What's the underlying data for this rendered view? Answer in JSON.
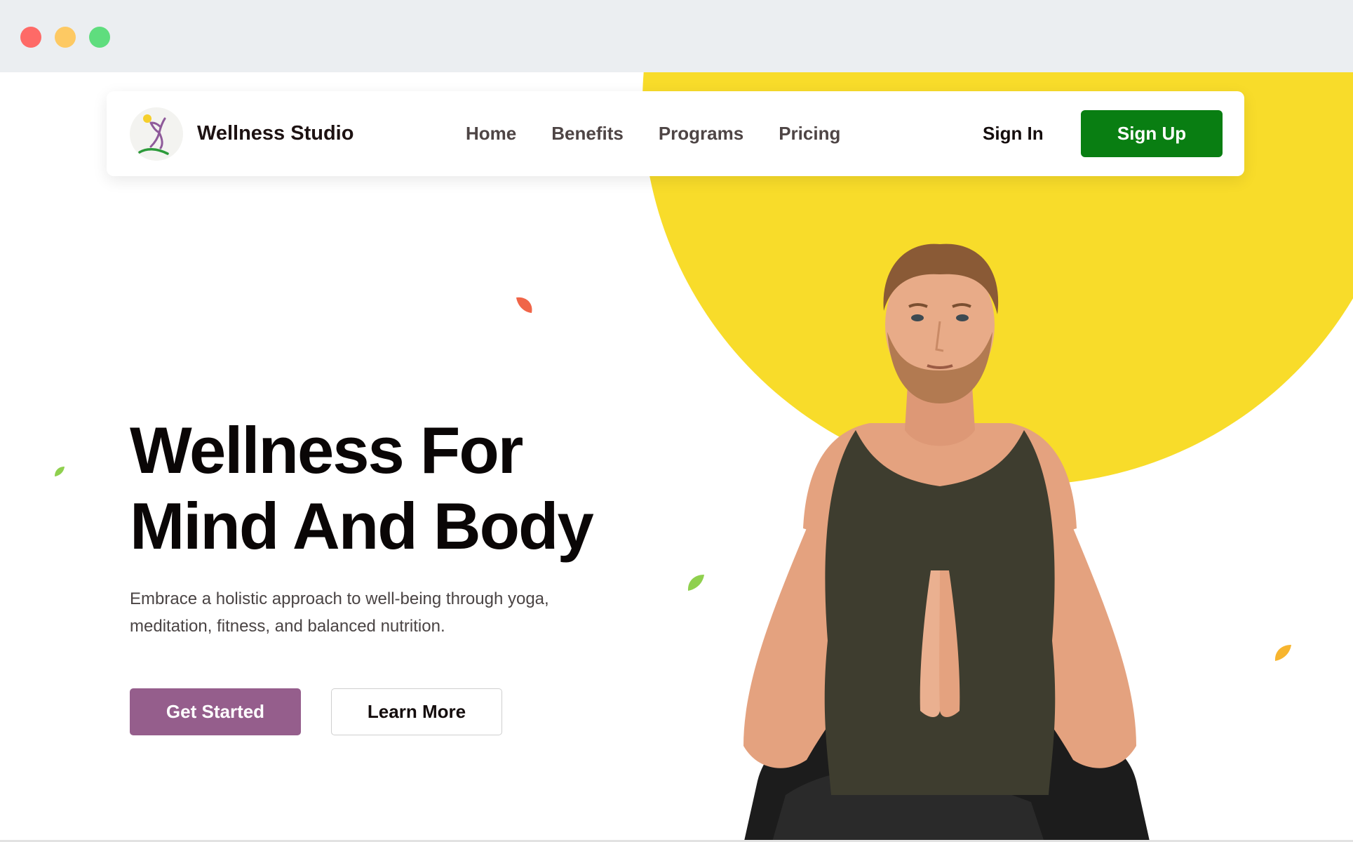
{
  "window": {
    "controls": [
      "close",
      "minimize",
      "maximize"
    ]
  },
  "header": {
    "brand_name": "Wellness Studio",
    "logo_icon": "dancing-figure-logo",
    "nav_links": [
      {
        "label": "Home"
      },
      {
        "label": "Benefits"
      },
      {
        "label": "Programs"
      },
      {
        "label": "Pricing"
      }
    ],
    "sign_in_label": "Sign In",
    "sign_up_label": "Sign Up"
  },
  "hero": {
    "title_line1": "Wellness For",
    "title_line2": "Mind And Body",
    "subtitle": "Embrace a holistic approach to well-being through yoga, meditation, fitness, and balanced nutrition.",
    "primary_cta_label": "Get Started",
    "secondary_cta_label": "Learn More",
    "image": "man-meditating-in-prayer-pose"
  },
  "colors": {
    "accent_yellow": "#f8dc2a",
    "sign_up_green": "#097e12",
    "primary_button_purple": "#955e8c",
    "leaf_red": "#f06548",
    "leaf_green": "#8fd04e",
    "leaf_orange": "#f7b52f"
  }
}
